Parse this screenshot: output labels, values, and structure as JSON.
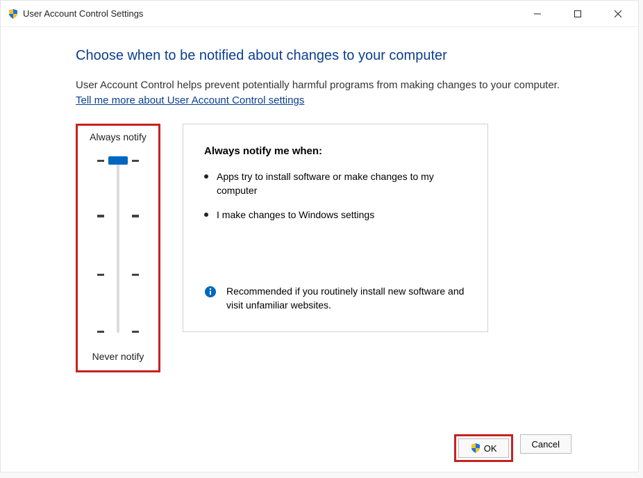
{
  "titlebar": {
    "title": "User Account Control Settings"
  },
  "heading": "Choose when to be notified about changes to your computer",
  "subheading": "User Account Control helps prevent potentially harmful programs from making changes to your computer.",
  "link_text": "Tell me more about User Account Control settings",
  "slider": {
    "top_label": "Always notify",
    "bottom_label": "Never notify",
    "levels": 4,
    "current_level": 0
  },
  "description": {
    "title": "Always notify me when:",
    "items": [
      "Apps try to install software or make changes to my computer",
      "I make changes to Windows settings"
    ],
    "recommendation": "Recommended if you routinely install new software and visit unfamiliar websites."
  },
  "buttons": {
    "ok": "OK",
    "cancel": "Cancel"
  }
}
